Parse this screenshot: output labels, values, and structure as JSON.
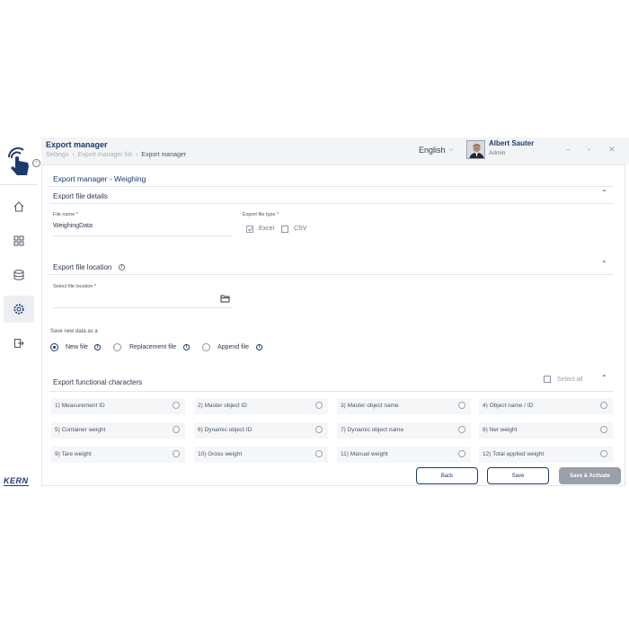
{
  "header": {
    "title": "Export manager",
    "breadcrumb": [
      "Settings",
      "Export manager list",
      "Export manager"
    ],
    "language": "English",
    "user_name": "Albert Sauter",
    "user_role": "Admin"
  },
  "brand": {
    "logo_text": "KERN"
  },
  "panel": {
    "title": "Export manager - Weighing",
    "file_details": {
      "heading": "Export file details",
      "file_name_label": "File name *",
      "file_name_value": "WeighingData",
      "file_type_label": "Export file type *",
      "excel_label": "Excel",
      "csv_label": "CSV",
      "excel_checked": true,
      "csv_checked": false
    },
    "file_location": {
      "heading": "Export file location",
      "select_label": "Select file location *",
      "select_value": ""
    },
    "save_as": {
      "label": "Save new data as a",
      "options": [
        "New file",
        "Replacement file",
        "Append file"
      ],
      "selected": "New file"
    },
    "functional": {
      "heading": "Export functional characters",
      "select_all_label": "Select all",
      "items": [
        "1)  Measurement ID",
        "2)  Master object ID",
        "3)  Master object name",
        "4)  Object name / ID",
        "5)  Container weight",
        "6)  Dynamic object ID",
        "7)  Dynamic object name",
        "8)  Net weight",
        "9)  Tare weight",
        "10)  Gross weight",
        "11)  Manual weight",
        "12)  Total applied weight"
      ]
    },
    "buttons": {
      "back": "Back",
      "save": "Save",
      "save_activate": "Save & Activate"
    }
  },
  "colors": {
    "primary": "#1d3a6e",
    "header_bg": "#f3f4f6",
    "cell_bg": "#f5f6f8",
    "disabled_btn": "#9aa0a8"
  }
}
